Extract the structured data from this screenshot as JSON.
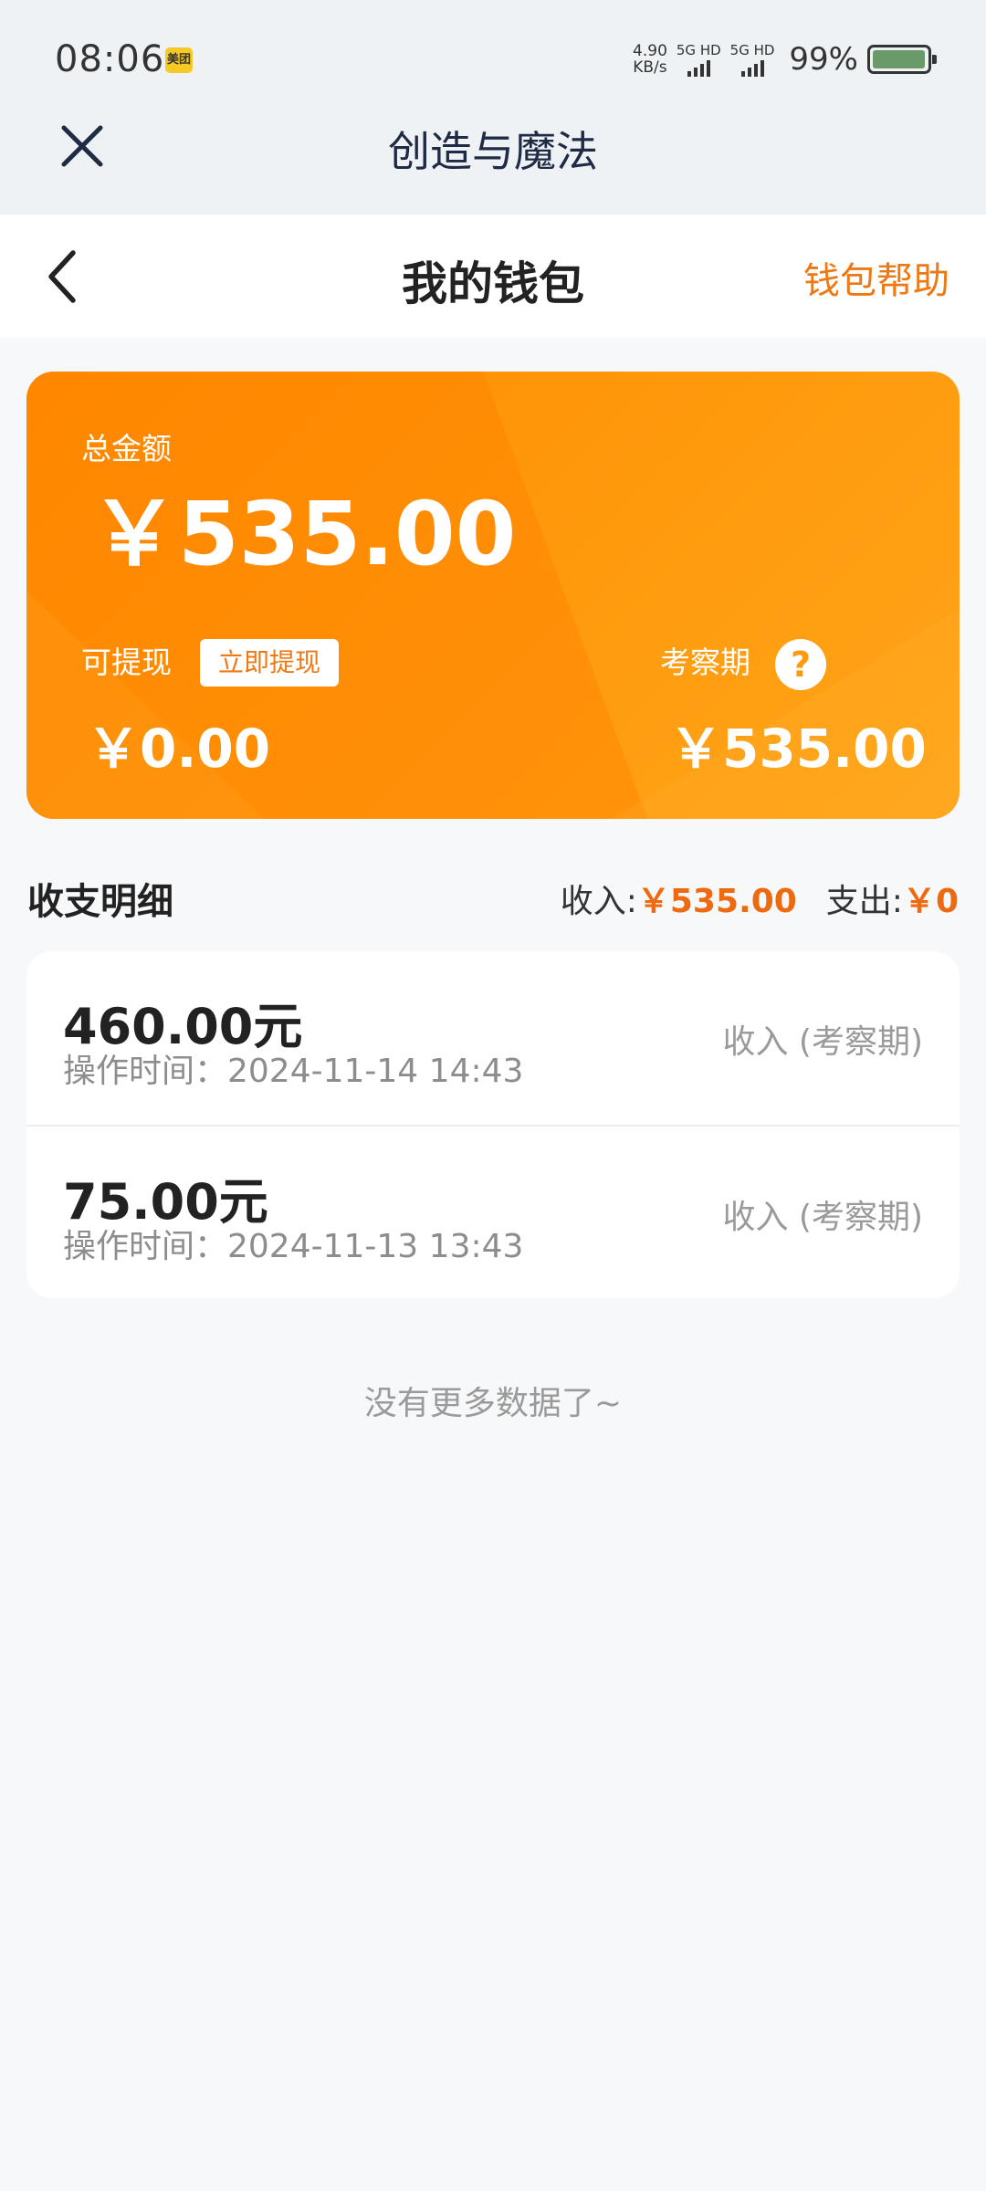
{
  "status_bar": {
    "time": "08:06",
    "app_badge": "美团",
    "speed_value": "4.90",
    "speed_unit": "KB/s",
    "sim1": "5G HD",
    "sim2": "5G HD",
    "battery_pct": "99%",
    "battery_level": 0.99
  },
  "mini_header": {
    "title": "创造与魔法"
  },
  "nav": {
    "title": "我的钱包",
    "help": "钱包帮助"
  },
  "wallet": {
    "total_label": "总金额",
    "total_amount": "￥535.00",
    "withdraw_label": "可提现",
    "withdraw_button": "立即提现",
    "withdraw_amount": "￥0.00",
    "review_label": "考察期",
    "review_help": "?",
    "review_amount": "￥535.00"
  },
  "details": {
    "title": "收支明细",
    "income_label": "收入:",
    "income_value": "￥535.00",
    "expense_label": "支出:",
    "expense_value": "￥0",
    "items": [
      {
        "amount": "460.00元",
        "time": "操作时间：2024-11-14 14:43",
        "type": "收入 (考察期)"
      },
      {
        "amount": "75.00元",
        "time": "操作时间：2024-11-13 13:43",
        "type": "收入 (考察期)"
      }
    ],
    "no_more": "没有更多数据了~"
  },
  "colors": {
    "accent": "#ee7814",
    "card_orange": "#ff9a0d",
    "header_bg": "#eef2f5"
  }
}
